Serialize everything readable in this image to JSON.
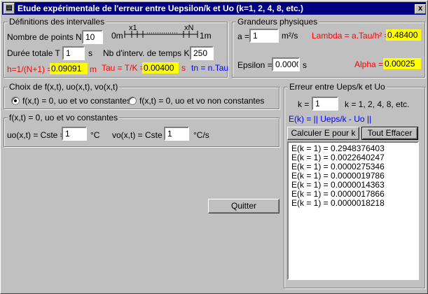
{
  "window": {
    "title": "Etude expérimentale de l'erreur entre Uepsilon/k et Uo (k=1, 2, 4, 8,  etc.)",
    "close": "x"
  },
  "defs": {
    "legend": "Définitions des intervalles",
    "n_label": "Nombre de points  N =",
    "n_value": "10",
    "t_label": "Durée totale T =",
    "t_value": "1",
    "t_unit": "s",
    "k_label": "Nb d'interv. de temps K =",
    "k_value": "250",
    "h_label": "h=1/(N+1) =",
    "h_value": "0.09091",
    "h_unit": "m",
    "tau_label": "Tau = T/K =",
    "tau_value": "0.00400",
    "tau_unit": "s",
    "tn_label": "tn = n.Tau",
    "diagram": {
      "x1": "x1",
      "xN": "xN",
      "left": "0m",
      "right": "1m"
    }
  },
  "phys": {
    "legend": "Grandeurs physiques",
    "a_label": "a =",
    "a_value": "1",
    "a_unit": "m²/s",
    "lambda_label": "Lambda = a.Tau/h² =",
    "lambda_value": "0.48400",
    "eps_label": "Epsilon =",
    "eps_value": "0.0000",
    "eps_unit": "s",
    "alpha_label": "Alpha =",
    "alpha_value": "0.00025"
  },
  "choix": {
    "legend": "Choix de f(x,t), uo(x,t), vo(x,t)",
    "opt1": "f(x,t) = 0, uo et vo constantes",
    "opt2": "f(x,t) = 0, uo et vo non constantes"
  },
  "const": {
    "legend": "f(x,t) = 0, uo et vo constantes",
    "uo_label": "uo(x,t) = Cste =",
    "uo_value": "1",
    "uo_unit": "°C",
    "vo_label": "vo(x,t) = Cste =",
    "vo_value": "1",
    "vo_unit": "°C/s"
  },
  "err": {
    "legend": "Erreur entre Ueps/k et Uo",
    "k_label": "k =",
    "k_value": "1",
    "k_hint": "k = 1, 2, 4, 8, etc.",
    "formula": "E(k) = || Ueps/k - Uo ||",
    "calc_button": "Calculer E pour k",
    "clear_button": "Tout Effacer",
    "results": [
      "E(k = 1) = 0.2948376403",
      "E(k = 1) = 0.0022640247",
      "E(k = 1) = 0.0000275346",
      "E(k = 1) = 0.0000019786",
      "E(k = 1) = 0.0000014363",
      "E(k = 1) = 0.0000017866",
      "E(k = 1) = 0.0000018218"
    ]
  },
  "quit_button": "Quitter"
}
